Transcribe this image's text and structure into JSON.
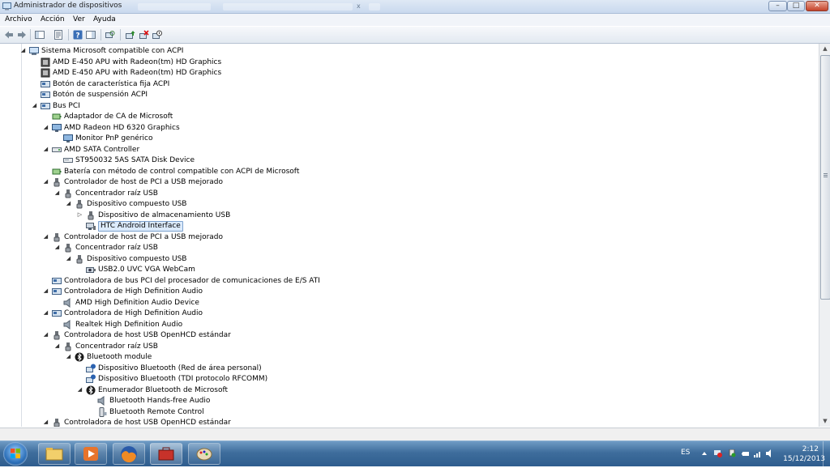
{
  "window": {
    "title": "Administrador de dispositivos",
    "minimize_label": "–",
    "maximize_label": "□",
    "close_label": "✕",
    "background_tab_close": "x"
  },
  "menu": [
    "Archivo",
    "Acción",
    "Ver",
    "Ayuda"
  ],
  "toolbar": [
    {
      "icon": "back-arrow-icon"
    },
    {
      "icon": "forward-arrow-icon"
    },
    {
      "icon": "show-hide-console-tree-icon"
    },
    {
      "icon": "properties-icon"
    },
    {
      "icon": "help-icon"
    },
    {
      "icon": "action-pane-icon"
    },
    {
      "icon": "scan-hardware-changes-icon"
    },
    {
      "icon": "update-driver-icon"
    },
    {
      "icon": "uninstall-icon"
    },
    {
      "icon": "disable-device-icon"
    }
  ],
  "tree": [
    {
      "level": 0,
      "expander": "expanded",
      "icon": "computer-icon",
      "label": "Sistema Microsoft compatible con ACPI"
    },
    {
      "level": 1,
      "expander": "none",
      "icon": "processor-icon",
      "label": "AMD E-450 APU with Radeon(tm) HD Graphics"
    },
    {
      "level": 1,
      "expander": "none",
      "icon": "processor-icon",
      "label": "AMD E-450 APU with Radeon(tm) HD Graphics"
    },
    {
      "level": 1,
      "expander": "none",
      "icon": "system-device-icon",
      "label": "Botón de característica fija ACPI"
    },
    {
      "level": 1,
      "expander": "none",
      "icon": "system-device-icon",
      "label": "Botón de suspensión ACPI"
    },
    {
      "level": 1,
      "expander": "expanded",
      "icon": "system-device-icon",
      "label": "Bus PCI"
    },
    {
      "level": 2,
      "expander": "none",
      "icon": "battery-icon",
      "label": "Adaptador de CA de Microsoft"
    },
    {
      "level": 2,
      "expander": "expanded",
      "icon": "monitor-icon",
      "label": "AMD Radeon HD 6320 Graphics"
    },
    {
      "level": 3,
      "expander": "none",
      "icon": "monitor-icon",
      "label": "Monitor PnP genérico"
    },
    {
      "level": 2,
      "expander": "expanded",
      "icon": "disk-controller-icon",
      "label": "AMD SATA Controller"
    },
    {
      "level": 3,
      "expander": "none",
      "icon": "disk-drive-icon",
      "label": "ST950032 5AS SATA Disk Device"
    },
    {
      "level": 2,
      "expander": "none",
      "icon": "battery-icon",
      "label": "Batería con método de control compatible con ACPI de Microsoft"
    },
    {
      "level": 2,
      "expander": "expanded",
      "icon": "usb-icon",
      "label": "Controlador de host de PCI a USB mejorado"
    },
    {
      "level": 3,
      "expander": "expanded",
      "icon": "usb-icon",
      "label": "Concentrador raíz USB"
    },
    {
      "level": 4,
      "expander": "expanded",
      "icon": "usb-icon",
      "label": "Dispositivo compuesto USB"
    },
    {
      "level": 5,
      "expander": "collapsed",
      "icon": "usb-icon",
      "label": "Dispositivo de almacenamiento USB"
    },
    {
      "level": 5,
      "expander": "none",
      "icon": "android-device-icon",
      "label": "HTC Android Interface",
      "selected": true
    },
    {
      "level": 2,
      "expander": "expanded",
      "icon": "usb-icon",
      "label": "Controlador de host de PCI a USB mejorado"
    },
    {
      "level": 3,
      "expander": "expanded",
      "icon": "usb-icon",
      "label": "Concentrador raíz USB"
    },
    {
      "level": 4,
      "expander": "expanded",
      "icon": "usb-icon",
      "label": "Dispositivo compuesto USB"
    },
    {
      "level": 5,
      "expander": "none",
      "icon": "webcam-icon",
      "label": "USB2.0 UVC VGA WebCam"
    },
    {
      "level": 2,
      "expander": "none",
      "icon": "system-device-icon",
      "label": "Controladora de bus PCI del procesador de comunicaciones de E/S ATI"
    },
    {
      "level": 2,
      "expander": "expanded",
      "icon": "system-device-icon",
      "label": "Controladora de High Definition Audio"
    },
    {
      "level": 3,
      "expander": "none",
      "icon": "speaker-icon",
      "label": "AMD High Definition Audio Device"
    },
    {
      "level": 2,
      "expander": "expanded",
      "icon": "system-device-icon",
      "label": "Controladora de High Definition Audio"
    },
    {
      "level": 3,
      "expander": "none",
      "icon": "speaker-icon",
      "label": "Realtek High Definition Audio"
    },
    {
      "level": 2,
      "expander": "expanded",
      "icon": "usb-icon",
      "label": "Controladora de host USB OpenHCD estándar"
    },
    {
      "level": 3,
      "expander": "expanded",
      "icon": "usb-icon",
      "label": "Concentrador raíz USB"
    },
    {
      "level": 4,
      "expander": "expanded",
      "icon": "bluetooth-icon",
      "label": "Bluetooth module"
    },
    {
      "level": 5,
      "expander": "none",
      "icon": "bluetooth-device-icon",
      "label": "Dispositivo Bluetooth (Red de área personal)"
    },
    {
      "level": 5,
      "expander": "none",
      "icon": "bluetooth-device-icon",
      "label": "Dispositivo Bluetooth (TDI protocolo RFCOMM)"
    },
    {
      "level": 5,
      "expander": "expanded",
      "icon": "bluetooth-icon",
      "label": "Enumerador Bluetooth de Microsoft"
    },
    {
      "level": 6,
      "expander": "none",
      "icon": "speaker-icon",
      "label": "Bluetooth Hands-free Audio"
    },
    {
      "level": 6,
      "expander": "none",
      "icon": "remote-control-icon",
      "label": "Bluetooth Remote Control"
    },
    {
      "level": 2,
      "expander": "expanded",
      "icon": "usb-icon",
      "label": "Controladora de host USB OpenHCD estándar"
    }
  ],
  "taskbar": {
    "pinned": [
      {
        "icon": "file-explorer-icon"
      },
      {
        "icon": "media-player-icon"
      },
      {
        "icon": "firefox-icon"
      },
      {
        "icon": "toolbox-app-icon",
        "active": true
      },
      {
        "icon": "paint-icon"
      }
    ],
    "tray": {
      "language": "ES",
      "time": "2:12",
      "date": "15/12/2013"
    }
  }
}
